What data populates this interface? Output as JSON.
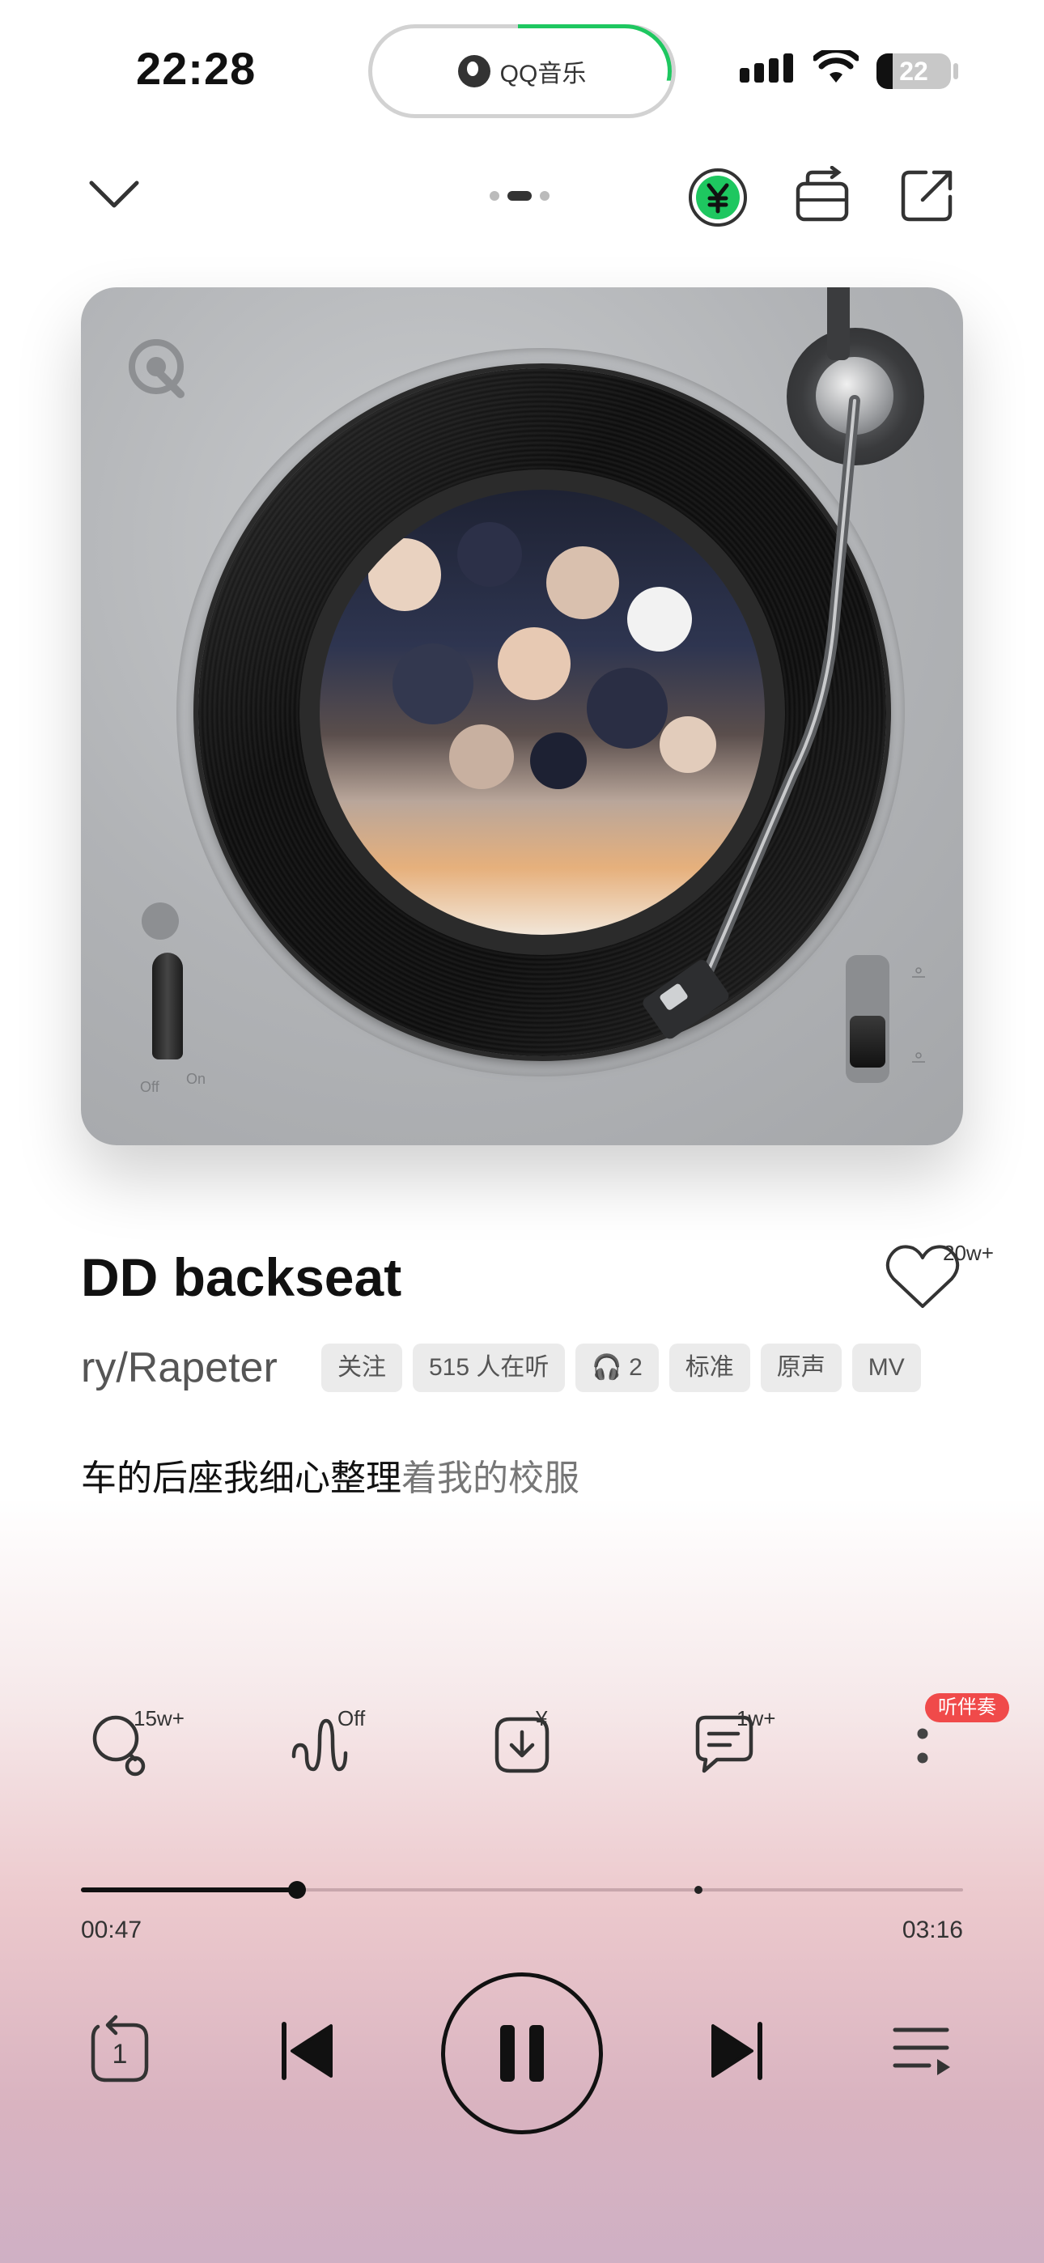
{
  "status_bar": {
    "time": "22:28",
    "island_app": "QQ音乐",
    "battery": "22",
    "accent_green": "#1ec760"
  },
  "header": {
    "collapse_icon": "chevron-down-icon",
    "vip_icon": "yen-vip-icon",
    "mode_icon": "switch-player-icon",
    "share_icon": "share-icon"
  },
  "player": {
    "deck_labels": {
      "off": "Off",
      "on": "On"
    }
  },
  "song": {
    "title": "DD backseat",
    "artist": "ry/Rapeter",
    "like_count": "20w+",
    "tags": [
      "关注",
      "515 人在听",
      "🎧 2",
      "标准",
      "原声",
      "MV"
    ],
    "lyric_sung": "车的后座我细心整理",
    "lyric_rest": "着我的校服"
  },
  "actions": {
    "search_count": "15w+",
    "effect_state": "Off",
    "download_badge": "¥",
    "comment_count": "1w+",
    "accompaniment_label": "听伴奏",
    "accompaniment_color": "#f04a4a"
  },
  "progress": {
    "current": "00:47",
    "total": "03:16",
    "played_fraction": 0.245
  },
  "controls": {
    "repeat_one": "1",
    "icons": [
      "repeat-one-icon",
      "previous-icon",
      "pause-icon",
      "next-icon",
      "playlist-icon"
    ]
  }
}
